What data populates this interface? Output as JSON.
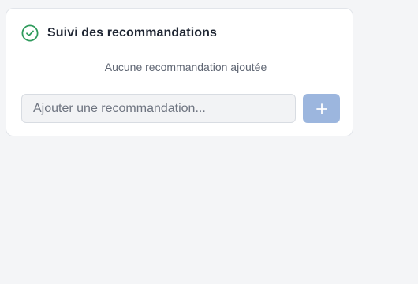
{
  "card": {
    "title": "Suivi des recommandations",
    "empty_message": "Aucune recommandation ajoutée",
    "input": {
      "placeholder": "Ajouter une recommandation...",
      "value": ""
    },
    "add_button": {
      "icon": "plus-icon"
    },
    "header_icon": "check-circle-icon"
  },
  "colors": {
    "accent_green": "#2e9a5b",
    "button_disabled": "#9cb6de",
    "background": "#f4f5f7"
  }
}
